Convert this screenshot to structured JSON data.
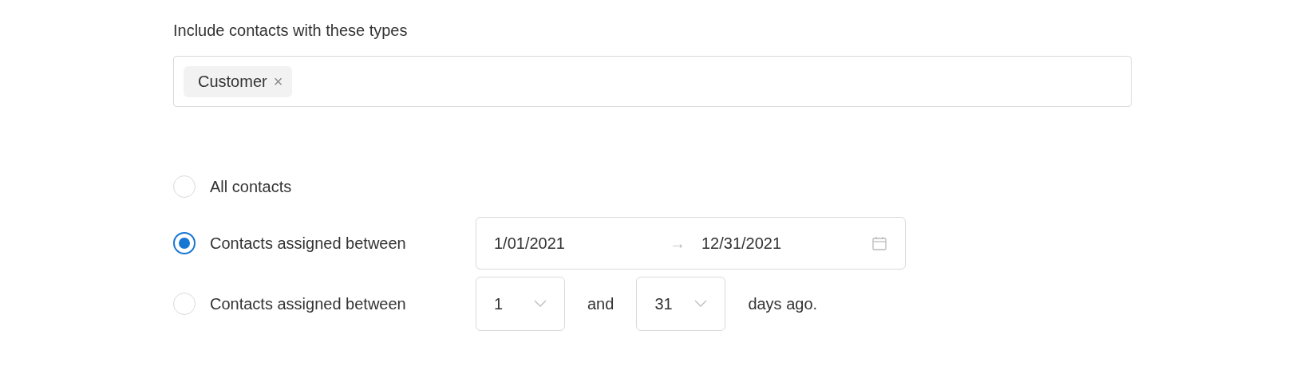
{
  "types_label": "Include contacts with these types",
  "tags": [
    {
      "label": "Customer",
      "remove": "×"
    }
  ],
  "options": [
    {
      "kind": "plain",
      "label": "All contacts",
      "selected": false
    },
    {
      "kind": "date_range",
      "label": "Contacts assigned between",
      "selected": true,
      "start": "1/01/2021",
      "arrow": "→",
      "end": "12/31/2021"
    },
    {
      "kind": "day_range",
      "label": "Contacts assigned between",
      "selected": false,
      "from": "1",
      "joiner": "and",
      "to": "31",
      "suffix": "days ago."
    }
  ]
}
